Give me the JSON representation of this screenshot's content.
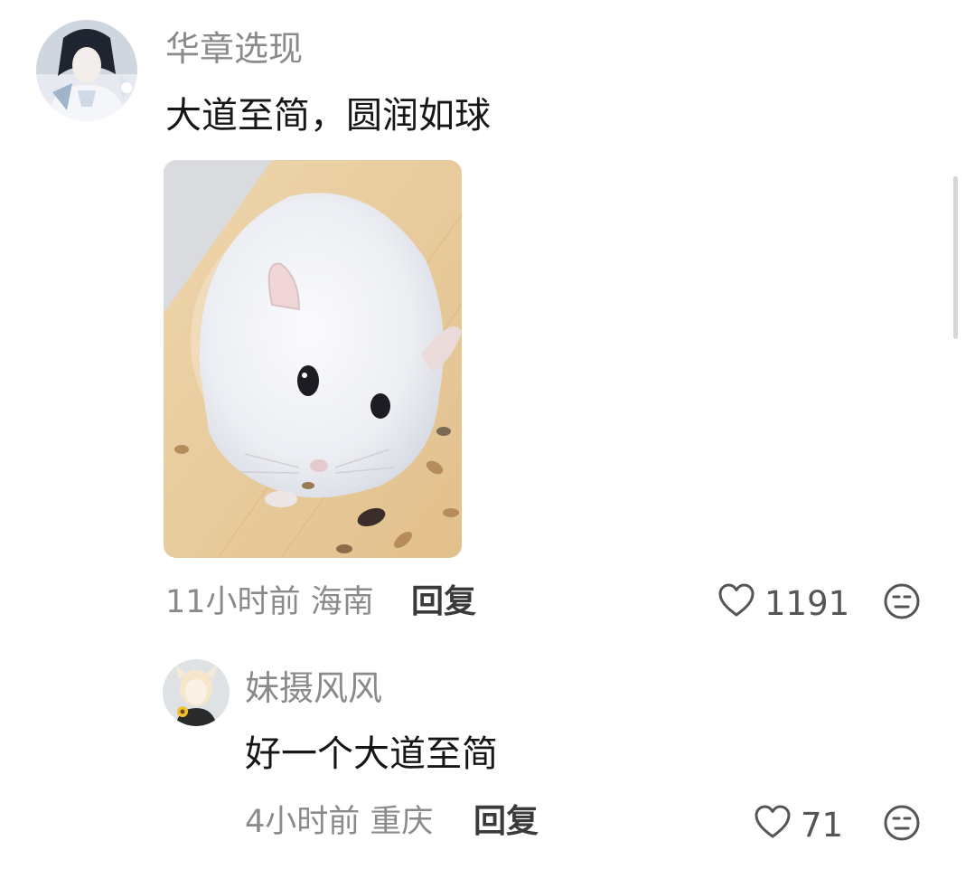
{
  "comment": {
    "username": "华章选现",
    "text": "大道至简，圆润如球",
    "time": "11小时前",
    "location": "海南",
    "reply_label": "回复",
    "likes": "1191",
    "like_icon": "heart-outline-icon",
    "react_icon": "neutral-face-icon"
  },
  "reply": {
    "username": "妹摄风风",
    "text": "好一个大道至简",
    "time": "4小时前",
    "location": "重庆",
    "reply_label": "回复",
    "likes": "71",
    "like_icon": "heart-outline-icon",
    "react_icon": "neutral-face-icon"
  },
  "colors": {
    "username": "#8a8a8a",
    "text": "#161616",
    "meta": "#8a8a8a",
    "reply": "#3a3a3a"
  }
}
